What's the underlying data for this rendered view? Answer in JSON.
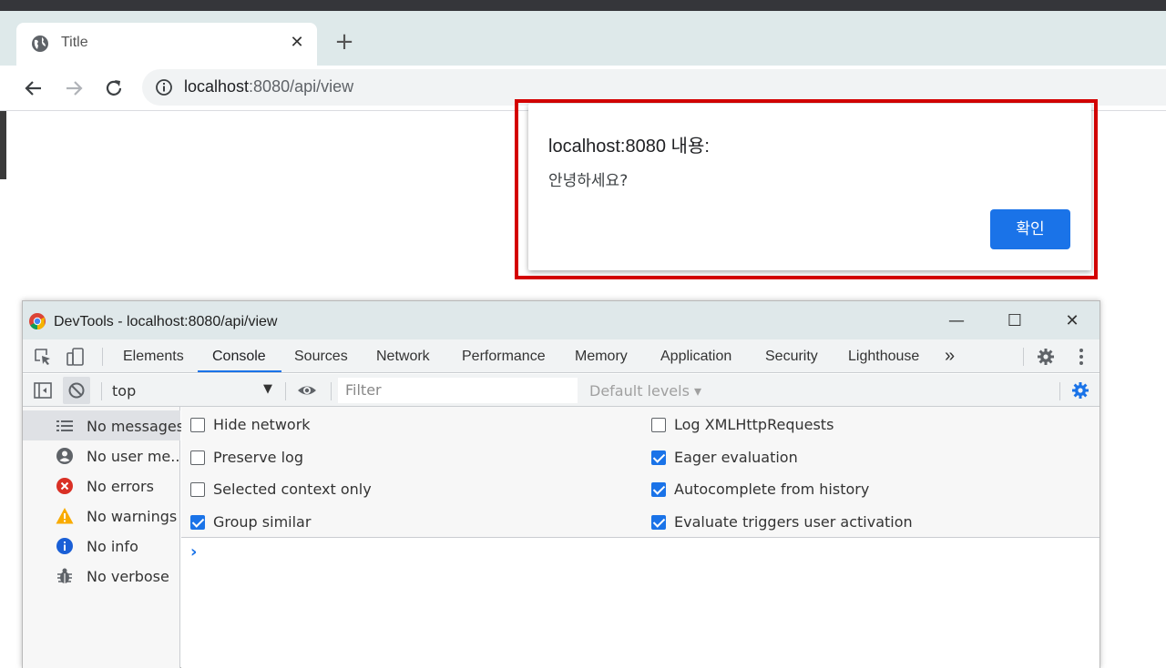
{
  "browser": {
    "tab_title": "Title",
    "tab_close": "✕",
    "new_tab": "+",
    "url_host": "localhost",
    "url_rest": ":8080/api/view"
  },
  "alert": {
    "heading": "localhost:8080 내용:",
    "message": "안녕하세요?",
    "ok_label": "확인",
    "highlight_color": "#d40000"
  },
  "devtools": {
    "window_title": "DevTools - localhost:8080/api/view",
    "tabs": [
      "Elements",
      "Console",
      "Sources",
      "Network",
      "Performance",
      "Memory",
      "Application",
      "Security",
      "Lighthouse"
    ],
    "active_tab": "Console",
    "more_tabs": "»",
    "context": "top",
    "filter_placeholder": "Filter",
    "levels": "Default levels ▾",
    "sidebar": [
      {
        "icon": "list-icon",
        "label": "No messages",
        "selected": true
      },
      {
        "icon": "user-icon",
        "label": "No user me..."
      },
      {
        "icon": "error-icon",
        "label": "No errors"
      },
      {
        "icon": "warning-icon",
        "label": "No warnings"
      },
      {
        "icon": "info-icon",
        "label": "No info"
      },
      {
        "icon": "bug-icon",
        "label": "No verbose"
      }
    ],
    "settings_left": [
      {
        "label": "Hide network",
        "checked": false
      },
      {
        "label": "Preserve log",
        "checked": false
      },
      {
        "label": "Selected context only",
        "checked": false
      },
      {
        "label": "Group similar",
        "checked": true
      }
    ],
    "settings_right": [
      {
        "label": "Log XMLHttpRequests",
        "checked": false
      },
      {
        "label": "Eager evaluation",
        "checked": true
      },
      {
        "label": "Autocomplete from history",
        "checked": true
      },
      {
        "label": "Evaluate triggers user activation",
        "checked": true
      }
    ],
    "prompt": "›",
    "accent": "#1a73e8"
  }
}
